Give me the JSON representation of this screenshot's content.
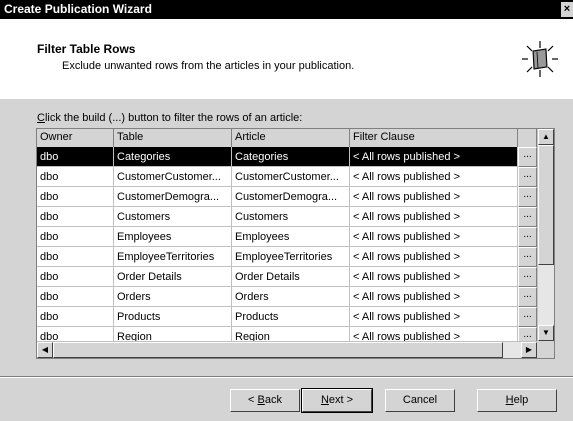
{
  "window": {
    "title": "Create Publication Wizard",
    "close_glyph": "×"
  },
  "header": {
    "title": "Filter Table Rows",
    "subtitle": "Exclude unwanted rows from the articles in your publication.",
    "icon": "book-light-icon"
  },
  "instruction": {
    "mnemonic": "C",
    "rest": "lick the build (...) button to filter the rows of an article:"
  },
  "grid": {
    "columns": [
      "Owner",
      "Table",
      "Article",
      "Filter Clause"
    ],
    "build_label": "...",
    "rows": [
      {
        "owner": "dbo",
        "table": "Categories",
        "article": "Categories",
        "filter": "< All rows published >",
        "selected": true
      },
      {
        "owner": "dbo",
        "table": "CustomerCustomer...",
        "article": "CustomerCustomer...",
        "filter": "< All rows published >"
      },
      {
        "owner": "dbo",
        "table": "CustomerDemogra...",
        "article": "CustomerDemogra...",
        "filter": "< All rows published >"
      },
      {
        "owner": "dbo",
        "table": "Customers",
        "article": "Customers",
        "filter": "< All rows published >"
      },
      {
        "owner": "dbo",
        "table": "Employees",
        "article": "Employees",
        "filter": "< All rows published >"
      },
      {
        "owner": "dbo",
        "table": "EmployeeTerritories",
        "article": "EmployeeTerritories",
        "filter": "< All rows published >"
      },
      {
        "owner": "dbo",
        "table": "Order Details",
        "article": "Order Details",
        "filter": "< All rows published >"
      },
      {
        "owner": "dbo",
        "table": "Orders",
        "article": "Orders",
        "filter": "< All rows published >"
      },
      {
        "owner": "dbo",
        "table": "Products",
        "article": "Products",
        "filter": "< All rows published >"
      },
      {
        "owner": "dbo",
        "table": "Region",
        "article": "Region",
        "filter": "< All rows published >"
      }
    ]
  },
  "buttons": {
    "back": {
      "prefix": "< ",
      "mnemonic": "B",
      "rest": "ack"
    },
    "next": {
      "mnemonic": "N",
      "rest": "ext >"
    },
    "cancel": {
      "label": "Cancel"
    },
    "help": {
      "mnemonic": "H",
      "rest": "elp"
    }
  }
}
